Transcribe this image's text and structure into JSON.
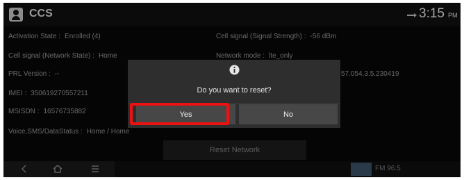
{
  "header": {
    "app_title": "CCS",
    "time": "3:15",
    "ampm": "PM",
    "icons": [
      "contact-card-icon",
      "signal-icon"
    ]
  },
  "info": {
    "activation_state": {
      "label": "Activation State :",
      "value": "Enrolled (4)"
    },
    "network_state": {
      "label": "Cell signal (Network State) :",
      "value": "Home"
    },
    "prl_version": {
      "label": "PRL Version :",
      "value": "--"
    },
    "imei": {
      "label": "IMEI :",
      "value": "350619270557211"
    },
    "msisdn": {
      "label": "MSISDN :",
      "value": "16576735882"
    },
    "voice_sms_data": {
      "label": "Voice,SMS/DataStatus :",
      "value": "Home / Home"
    },
    "signal_strength": {
      "label": "Cell signal (Signal Strength) :",
      "value": "-56 dBm"
    },
    "network_mode": {
      "label": "Network mode :",
      "value": "lte_only"
    },
    "firmware": {
      "value": "57.054.3.5.230419"
    }
  },
  "reset_network_label": "Reset Network",
  "bottom_bar": {
    "radio_label": "FM 96.5",
    "nav_icons": [
      "back-icon",
      "home-icon",
      "menu-icon"
    ]
  },
  "dialog": {
    "icon": "info-icon",
    "message": "Do you want to reset?",
    "yes_label": "Yes",
    "no_label": "No"
  },
  "colors": {
    "background": "#050505",
    "dialog": "#2e2e2e",
    "button": "#474747",
    "highlight": "#ee1111"
  }
}
